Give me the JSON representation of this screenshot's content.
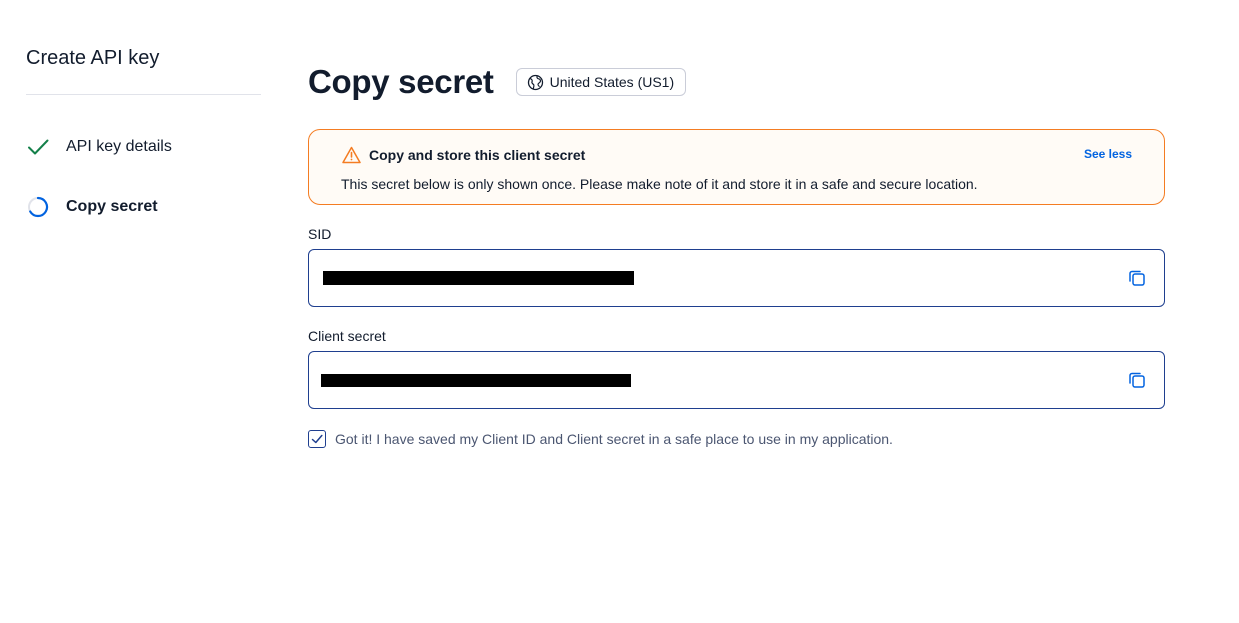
{
  "sidebar": {
    "title": "Create API key",
    "steps": [
      {
        "label": "API key details",
        "state": "complete"
      },
      {
        "label": "Copy secret",
        "state": "in-progress"
      }
    ]
  },
  "main": {
    "title": "Copy secret",
    "region": "United States (US1)",
    "callout": {
      "title": "Copy and store this client secret",
      "body": "This secret below is only shown once. Please make note of it and store it in a safe and secure location.",
      "link": "See less"
    },
    "sid": {
      "label": "SID",
      "value": "",
      "redacted": true
    },
    "client_secret": {
      "label": "Client secret",
      "value": "",
      "redacted": true
    },
    "confirm": {
      "label": "Got it! I have saved my Client ID and Client secret in a safe place to use in my application.",
      "checked": true
    }
  },
  "colors": {
    "check_green": "#14b053",
    "spinner_blue": "#0263e0",
    "warning_orange": "#f47c22",
    "field_border": "#1f3f8f",
    "link_blue": "#0263e0"
  }
}
